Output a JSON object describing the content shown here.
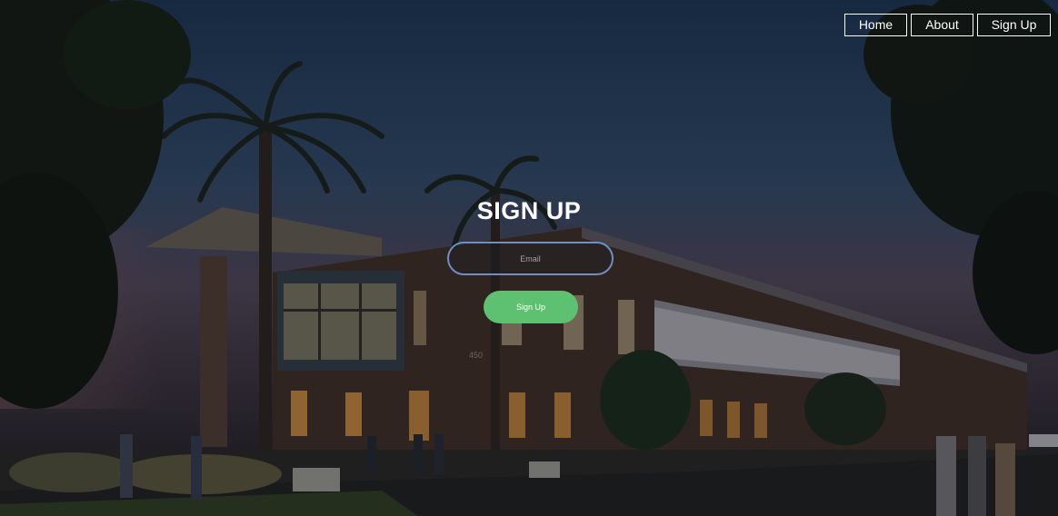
{
  "nav": {
    "home_label": "Home",
    "about_label": "About",
    "signup_label": "Sign Up"
  },
  "form": {
    "title": "SIGN UP",
    "email_placeholder": "Email",
    "submit_label": "Sign Up"
  },
  "building_sign": "450",
  "colors": {
    "accent_green": "#5ec171",
    "input_border": "#6c8fc4",
    "nav_border": "#ffffff",
    "text": "#ffffff"
  },
  "icons": [
    "building-background-image"
  ]
}
